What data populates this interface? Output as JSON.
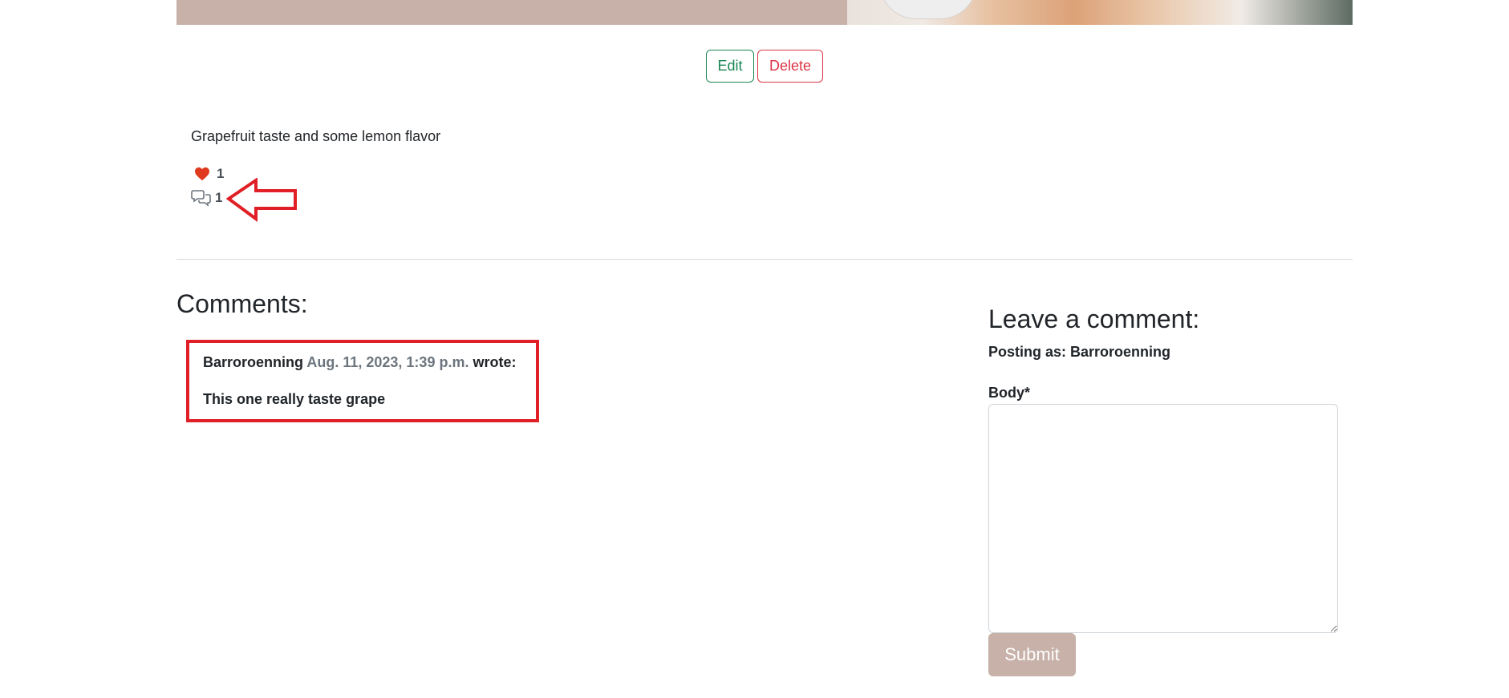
{
  "post": {
    "actions": {
      "edit_label": "Edit",
      "delete_label": "Delete"
    },
    "excerpt": "Grapefruit taste and some lemon flavor",
    "likes_count": "1",
    "comments_count": "1"
  },
  "comments": {
    "heading": "Comments:",
    "items": [
      {
        "author": "Barroroenning",
        "date": "Aug. 11, 2023, 1:39 p.m.",
        "wrote": "wrote:",
        "body": "This one really taste grape"
      }
    ]
  },
  "comment_form": {
    "heading": "Leave a comment:",
    "posting_as": "Posting as: Barroroenning",
    "body_label": "Body*",
    "body_value": "",
    "submit_label": "Submit"
  },
  "icons": {
    "like": "heart-icon",
    "comments": "chat-bubbles-icon",
    "annotation": "arrow-left-outline"
  },
  "colors": {
    "accent": "#c7b1a8",
    "edit": "#198754",
    "delete": "#dc3545",
    "heart": "#e03a1e",
    "annotation": "#e01f26",
    "muted": "#6c757d"
  }
}
